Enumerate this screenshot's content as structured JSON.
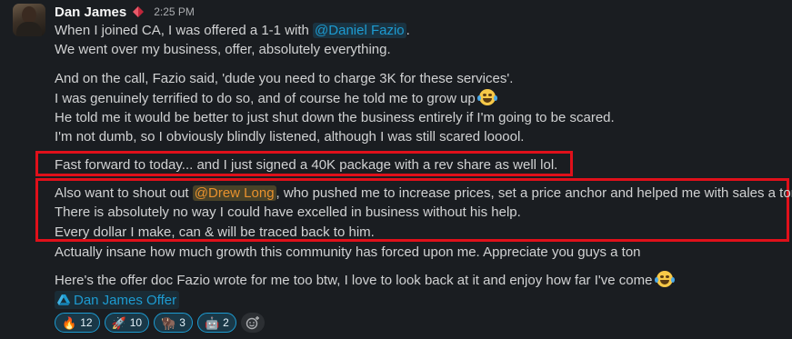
{
  "message": {
    "author": "Dan James",
    "time": "2:25 PM",
    "lines": {
      "l1_pre": "When I joined CA, I was offered a 1-1 with ",
      "l1_mention": "@Daniel Fazio",
      "l1_post": ".",
      "l2": "We went over my business, offer, absolutely everything.",
      "l3": "And on the call, Fazio said, 'dude you need to charge 3K for these services'.",
      "l4": "I was genuinely terrified to do so, and of course he told me to grow up",
      "l5": "He told me it would be better to just shut down the business entirely if I'm going to be scared.",
      "l6": "I'm not dumb, so I obviously blindly listened, although I was still scared looool.",
      "l7": "Fast forward to today... and I just signed a 40K package with a rev share as well lol.",
      "l8_pre": "Also want to shout out ",
      "l8_mention": "@Drew Long",
      "l8_post": ", who pushed me to increase prices, set a price anchor and helped me with sales a ton.",
      "l9": "There is absolutely no way I could have excelled in business without his help.",
      "l10": "Every dollar I make, can & will be traced back to him.",
      "l11": "Actually insane how much growth this community has forced upon me. Appreciate you guys a ton",
      "l12": "Here's the offer doc Fazio wrote for me too btw, I love to look back at it and enjoy how far I've come"
    },
    "attachment": {
      "label": "Dan James Offer",
      "icon": "google-drive-icon"
    }
  },
  "reactions": [
    {
      "icon": "fire-icon",
      "glyph": "🔥",
      "count": "12"
    },
    {
      "icon": "rocket-icon",
      "glyph": "🚀",
      "count": "10"
    },
    {
      "icon": "bison-icon",
      "glyph": "🦬",
      "count": "3"
    },
    {
      "icon": "robot-icon",
      "glyph": "🤖",
      "count": "2"
    }
  ],
  "colors": {
    "highlight_box": "#e0101a",
    "mention": "#1d9bd1",
    "background": "#1a1d21"
  }
}
